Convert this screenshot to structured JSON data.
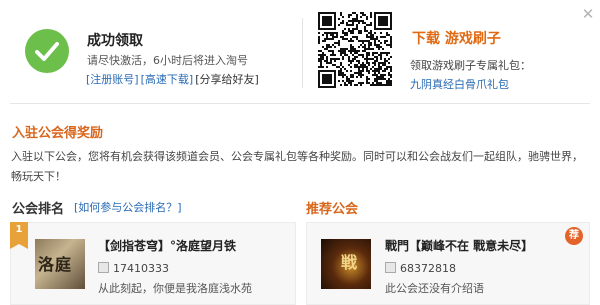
{
  "success": {
    "title": "成功领取",
    "subtitle": "请尽快激活，6小时后将进入淘号",
    "links": [
      "[注册账号]",
      "[高速下载]"
    ],
    "share": "[分享给好友]"
  },
  "download": {
    "title": "下载 游戏刷子",
    "subtitle": "领取游戏刷子专属礼包：",
    "gift_link": "九阴真经白骨爪礼包"
  },
  "section": {
    "title": "入驻公会得奖励",
    "body": "入驻以下公会，您将有机会获得该频道会员、公会专属礼包等各种奖励。同时可以和公会战友们一起组队，驰骋世界，畅玩天下！"
  },
  "guild_rank": {
    "title": "公会排名",
    "how_link": "[如何参与公会排名？]",
    "rank": "1",
    "thumb_text": "洛庭",
    "name": "【剑指苍穹】°洛庭望月铁",
    "id": "17410333",
    "desc": "从此刻起，你便是我洛庭浅水苑"
  },
  "recommend": {
    "title": "推荐公会",
    "badge": "荐",
    "thumb_text": "戦",
    "name": "戰門【巅峰不在 戰意未尽】",
    "id": "68372818",
    "desc": "此公会还没有介绍语"
  },
  "icons": {
    "close": "close-icon",
    "success": "checkmark-icon",
    "qr": "qr-code-icon"
  },
  "colors": {
    "success_green": "#6cbf4a",
    "accent_orange": "#e06a14",
    "link_blue": "#2a6bb5"
  }
}
